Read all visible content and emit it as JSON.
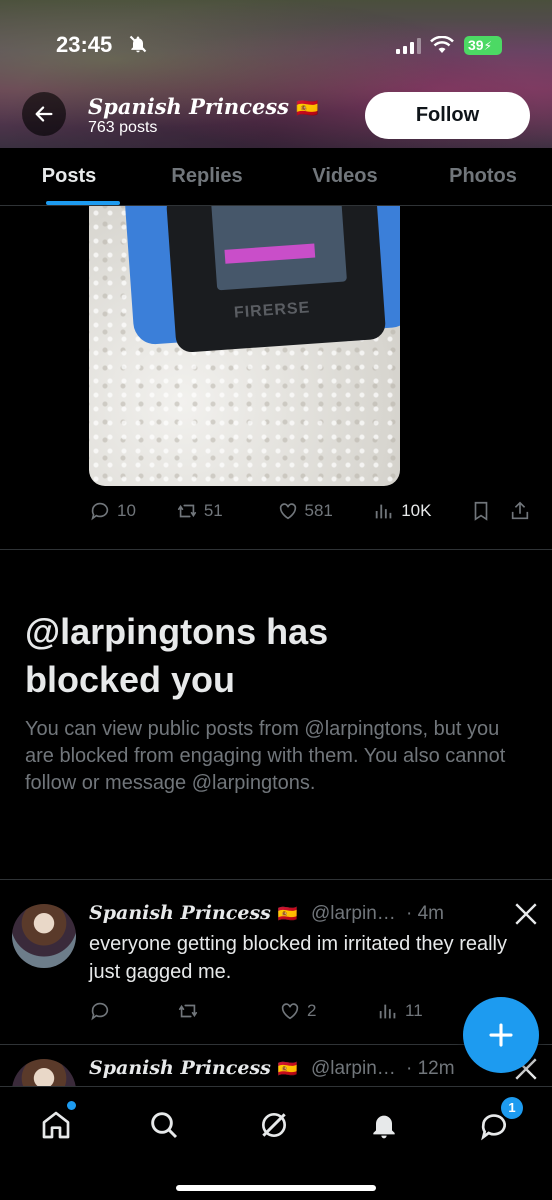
{
  "status_bar": {
    "time": "23:45",
    "battery": "39"
  },
  "header": {
    "name": "Spanish Princess",
    "flag": "🇪🇸",
    "post_count": "763 posts",
    "follow_label": "Follow"
  },
  "tabs": [
    {
      "label": "Posts",
      "active": true
    },
    {
      "label": "Replies",
      "active": false
    },
    {
      "label": "Videos",
      "active": false
    },
    {
      "label": "Photos",
      "active": false
    }
  ],
  "first_post": {
    "media_text": "FIRERSE",
    "replies": "10",
    "reposts": "51",
    "likes": "581",
    "views": "10K"
  },
  "blocked": {
    "title": "@larpingtons has blocked you",
    "body": "You can view public posts from @larpingtons, but you are blocked from engaging with them. You also cannot follow or message @larpingtons."
  },
  "tweets": [
    {
      "name": "Spanish Princess",
      "flag": "🇪🇸",
      "handle": "@larpin…",
      "time": "· 4m",
      "text": "everyone getting blocked im irritated they really just gagged me.",
      "replies": "",
      "reposts": "",
      "likes": "2",
      "views": "11"
    },
    {
      "name": "Spanish Princess",
      "flag": "🇪🇸",
      "handle": "@larpin…",
      "time": "· 12m"
    }
  ],
  "bottom_nav": {
    "messages_badge": "1"
  },
  "colors": {
    "accent": "#1d9bf0",
    "muted": "#71767b",
    "text": "#e7e9ea",
    "divider": "#2f3336"
  },
  "icons": [
    "back-arrow-icon",
    "bell-off-icon",
    "signal-icon",
    "wifi-icon",
    "reply-icon",
    "repost-icon",
    "like-icon",
    "views-icon",
    "bookmark-icon",
    "share-icon",
    "x-logo-icon",
    "plus-icon",
    "home-icon",
    "search-icon",
    "grok-icon",
    "notifications-icon",
    "messages-icon"
  ]
}
